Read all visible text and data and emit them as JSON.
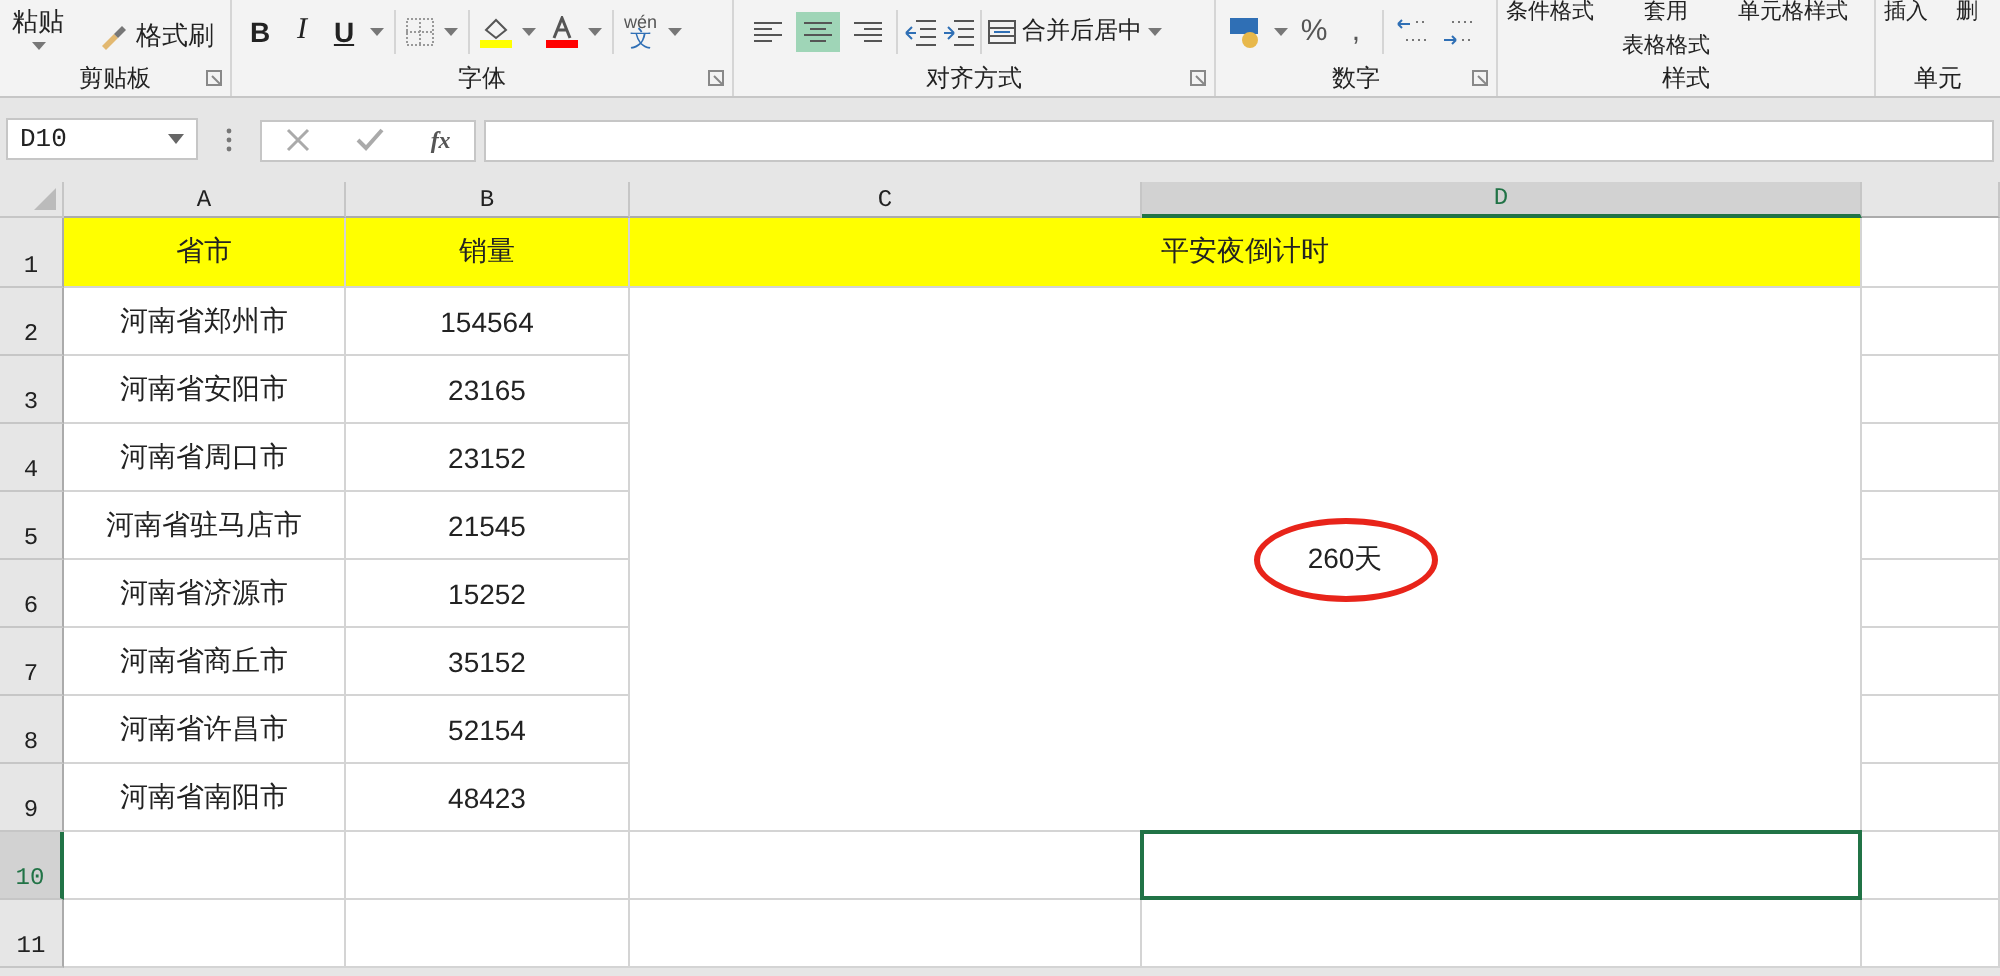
{
  "ribbon": {
    "clipboard": {
      "paste": "粘贴",
      "format_painter": "格式刷",
      "label": "剪贴板"
    },
    "font": {
      "bold": "B",
      "italic": "I",
      "underline": "U",
      "phonetic_top": "wén",
      "phonetic_bottom": "文",
      "label": "字体"
    },
    "alignment": {
      "align_buttons": [
        {
          "kind": "left",
          "selected": false
        },
        {
          "kind": "center",
          "selected": true
        },
        {
          "kind": "right",
          "selected": false
        }
      ],
      "merge": "合并后居中",
      "label": "对齐方式"
    },
    "number": {
      "percent": "%",
      "comma": ",",
      "label": "数字"
    },
    "styles": {
      "conditional": "条件格式",
      "table_top": "套用",
      "table_bottom": "表格格式",
      "cell_styles": "单元格样式",
      "label": "样式"
    },
    "cells": {
      "insert": "插入",
      "delete": "删",
      "label": "单元"
    }
  },
  "formula_bar": {
    "name_box": "D10",
    "fx": "fx"
  },
  "columns": [
    {
      "label": "A",
      "selected": false
    },
    {
      "label": "B",
      "selected": false
    },
    {
      "label": "C",
      "selected": false
    },
    {
      "label": "D",
      "selected": true
    }
  ],
  "rows": [
    {
      "label": "1",
      "selected": false
    },
    {
      "label": "2",
      "selected": false
    },
    {
      "label": "3",
      "selected": false
    },
    {
      "label": "4",
      "selected": false
    },
    {
      "label": "5",
      "selected": false
    },
    {
      "label": "6",
      "selected": false
    },
    {
      "label": "7",
      "selected": false
    },
    {
      "label": "8",
      "selected": false
    },
    {
      "label": "9",
      "selected": false
    },
    {
      "label": "10",
      "selected": true
    },
    {
      "label": "11",
      "selected": false
    }
  ],
  "header": {
    "col_a": "省市",
    "col_b": "销量",
    "title": "平安夜倒计时"
  },
  "data": [
    {
      "province": "河南省郑州市",
      "sales": "154564"
    },
    {
      "province": "河南省安阳市",
      "sales": "23165"
    },
    {
      "province": "河南省周口市",
      "sales": "23152"
    },
    {
      "province": "河南省驻马店市",
      "sales": "21545"
    },
    {
      "province": "河南省济源市",
      "sales": "15252"
    },
    {
      "province": "河南省商丘市",
      "sales": "35152"
    },
    {
      "province": "河南省许昌市",
      "sales": "52154"
    },
    {
      "province": "河南省南阳市",
      "sales": "48423"
    }
  ],
  "countdown": {
    "text": "260天",
    "circled": true
  }
}
